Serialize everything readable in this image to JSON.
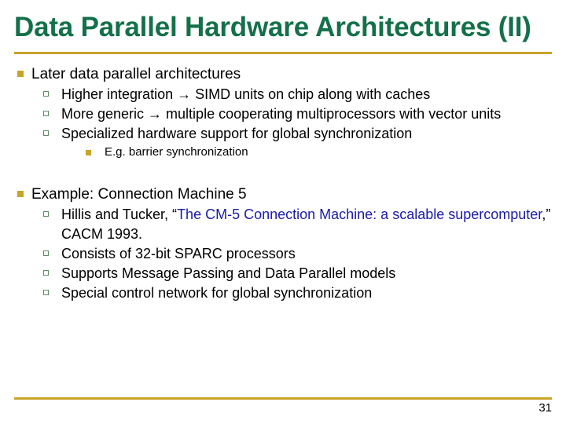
{
  "slide": {
    "title": "Data Parallel Hardware Architectures (II)",
    "accent_color": "#C9A227",
    "title_color": "#14704A",
    "link_color": "#1B1BA8",
    "page_number": "31",
    "bullets": {
      "b1": "Later data parallel architectures",
      "b1_1": "Higher integration → SIMD units on chip along with caches",
      "b1_2": "More generic → multiple cooperating multiprocessors with vector units",
      "b1_3": "Specialized hardware support for global synchronization",
      "b1_3_1": "E.g. barrier synchronization",
      "b2": "Example: Connection Machine 5",
      "b2_1_pre": "Hillis and Tucker, “",
      "b2_1_link": "The CM-5 Connection Machine: a scalable supercomputer",
      "b2_1_post": ",” CACM 1993.",
      "b2_2": "Consists of 32-bit SPARC processors",
      "b2_3": "Supports Message Passing and Data Parallel models",
      "b2_4": "Special control network for global synchronization"
    }
  }
}
